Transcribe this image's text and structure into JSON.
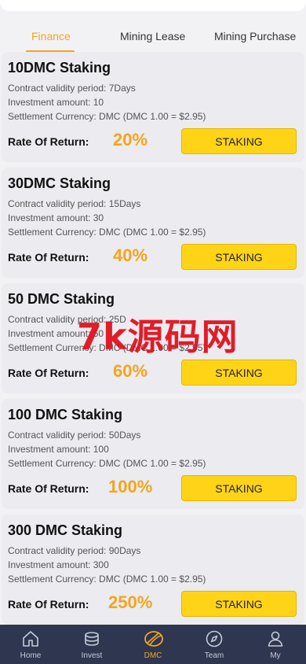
{
  "tabs": [
    {
      "label": "Finance",
      "active": true
    },
    {
      "label": "Mining Lease",
      "active": false
    },
    {
      "label": "Mining Purchase",
      "active": false
    }
  ],
  "cards": [
    {
      "title": "10DMC Staking",
      "period": "Contract validity period: 7Days",
      "amount": "Investment amount: 10",
      "currency": "Settlement Currency: DMC (DMC 1.00 = $2.95)",
      "rate_label": "Rate Of Return:",
      "rate": "20%",
      "button": "STAKING"
    },
    {
      "title": "30DMC Staking",
      "period": "Contract validity period: 15Days",
      "amount": "Investment amount: 30",
      "currency": "Settlement Currency: DMC (DMC 1.00 = $2.95)",
      "rate_label": "Rate Of Return:",
      "rate": "40%",
      "button": "STAKING"
    },
    {
      "title": "50 DMC Staking",
      "period": "Contract validity period: 25D",
      "amount": "Investment amount: 50",
      "currency": "Settlement Currency: DMC (DMC 1.00 = $2.95)",
      "rate_label": "Rate Of Return:",
      "rate": "60%",
      "button": "STAKING"
    },
    {
      "title": "100 DMC Staking",
      "period": "Contract validity period: 50Days",
      "amount": "Investment amount: 100",
      "currency": "Settlement Currency: DMC (DMC 1.00 = $2.95)",
      "rate_label": "Rate Of Return:",
      "rate": "100%",
      "button": "STAKING"
    },
    {
      "title": "300 DMC Staking",
      "period": "Contract validity period: 90Days",
      "amount": "Investment amount: 300",
      "currency": "Settlement Currency: DMC (DMC 1.00 = $2.95)",
      "rate_label": "Rate Of Return:",
      "rate": "250%",
      "button": "STAKING"
    }
  ],
  "watermark": "7k源码网",
  "tabbar": [
    {
      "label": "Home",
      "icon": "home-icon",
      "active": false
    },
    {
      "label": "Invest",
      "icon": "coins-icon",
      "active": false
    },
    {
      "label": "DMC",
      "icon": "dmc-icon",
      "active": true
    },
    {
      "label": "Team",
      "icon": "compass-icon",
      "active": false
    },
    {
      "label": "My",
      "icon": "user-icon",
      "active": false
    }
  ],
  "colors": {
    "accent": "#f2a51f",
    "button": "#ffd417",
    "tabbar_bg": "#2e3650",
    "card_bg": "#ebebf0",
    "watermark": "#e0121e"
  }
}
